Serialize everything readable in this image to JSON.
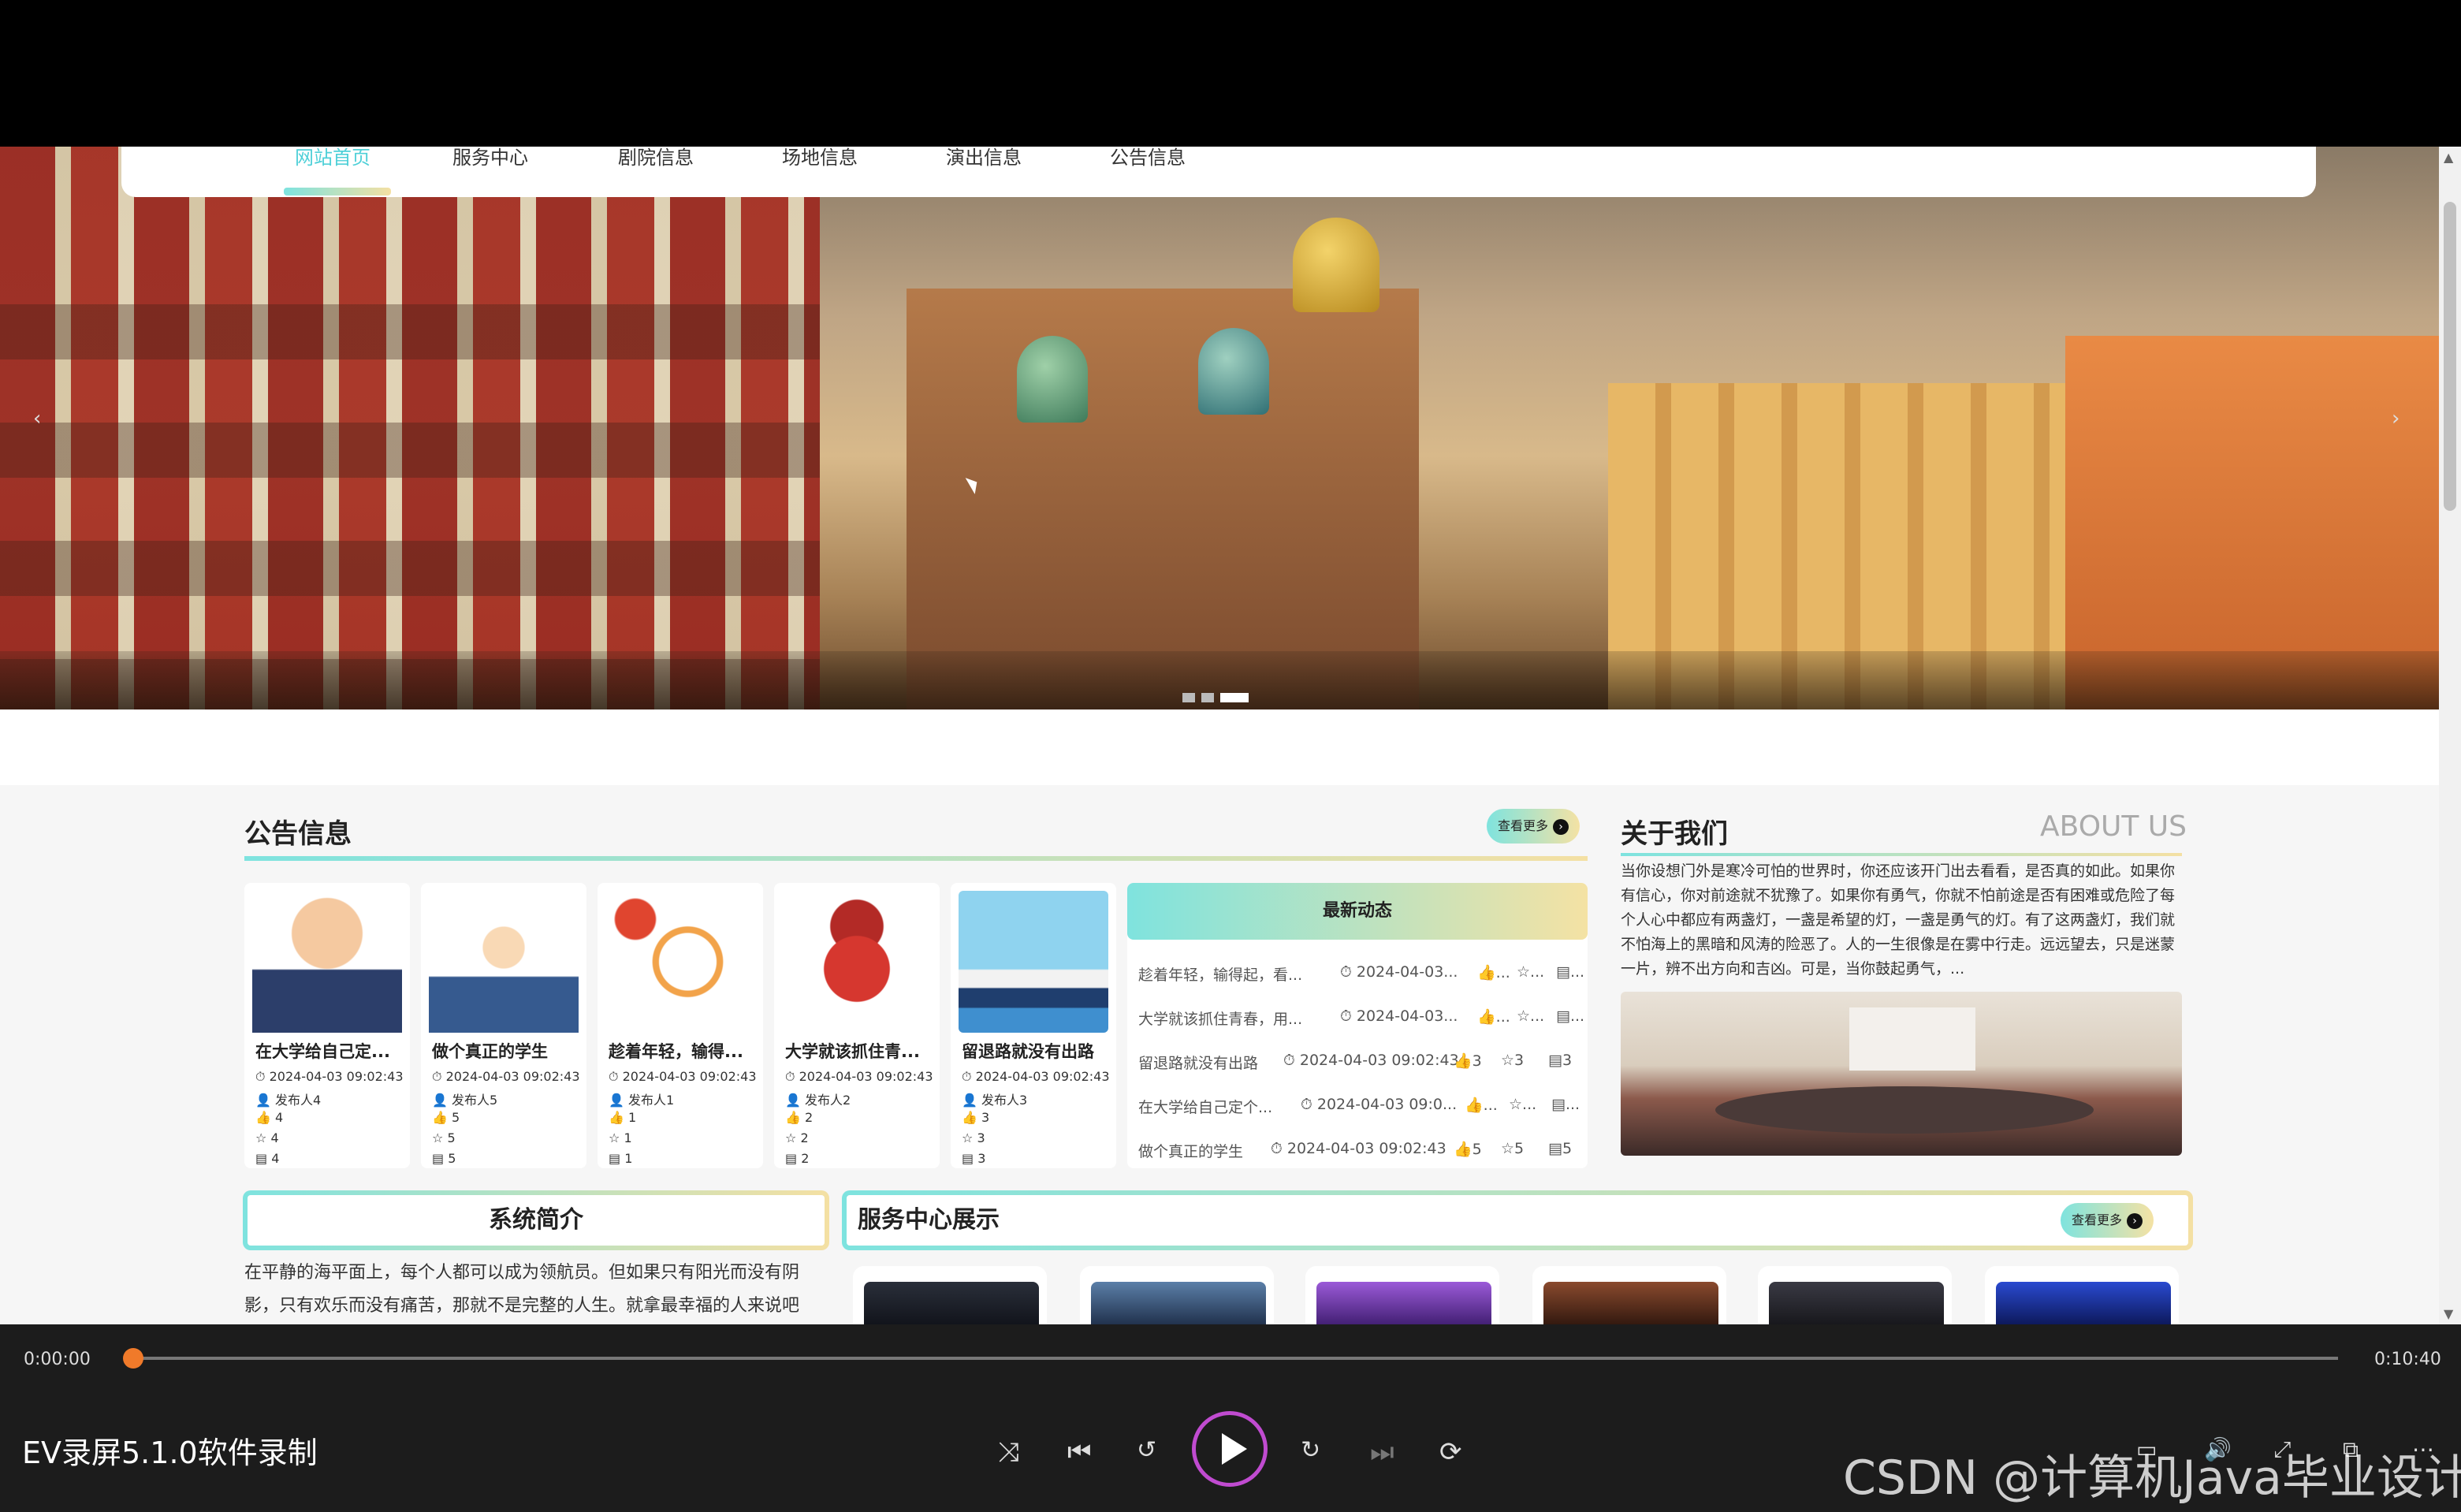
{
  "nav": {
    "items": [
      "网站首页",
      "服务中心",
      "剧院信息",
      "场地信息",
      "演出信息",
      "公告信息"
    ],
    "active_index": 0
  },
  "carousel": {
    "prev_icon": "‹",
    "next_icon": "›",
    "slide_count": 3,
    "active_slide": 3
  },
  "notices": {
    "title": "公告信息",
    "more_label": "查看更多",
    "cards": [
      {
        "title": "在大学给自己定...",
        "time": "2024-04-03 09:02:43",
        "author": "发布人4",
        "likes": "4",
        "favorites": "4",
        "views": "4"
      },
      {
        "title": "做个真正的学生",
        "time": "2024-04-03 09:02:43",
        "author": "发布人5",
        "likes": "5",
        "favorites": "5",
        "views": "5"
      },
      {
        "title": "趁着年轻，输得...",
        "time": "2024-04-03 09:02:43",
        "author": "发布人1",
        "likes": "1",
        "favorites": "1",
        "views": "1"
      },
      {
        "title": "大学就该抓住青...",
        "time": "2024-04-03 09:02:43",
        "author": "发布人2",
        "likes": "2",
        "favorites": "2",
        "views": "2"
      },
      {
        "title": "留退路就没有出路",
        "time": "2024-04-03 09:02:43",
        "author": "发布人3",
        "likes": "3",
        "favorites": "3",
        "views": "3"
      }
    ]
  },
  "news": {
    "title": "最新动态",
    "rows": [
      {
        "title": "趁着年轻，输得起，看...",
        "time": "2024-04-03...",
        "likes": "...",
        "favorites": "...",
        "views": "..."
      },
      {
        "title": "大学就该抓住青春，用...",
        "time": "2024-04-03...",
        "likes": "...",
        "favorites": "...",
        "views": "..."
      },
      {
        "title": "留退路就没有出路",
        "time": "2024-04-03 09:02:43",
        "likes": "3",
        "favorites": "3",
        "views": "3"
      },
      {
        "title": "在大学给自己定个...",
        "time": "2024-04-03 09:0...",
        "likes": "...",
        "favorites": "...",
        "views": "..."
      },
      {
        "title": "做个真正的学生",
        "time": "2024-04-03 09:02:43",
        "likes": "5",
        "favorites": "5",
        "views": "5"
      }
    ]
  },
  "about": {
    "title": "关于我们",
    "subtitle_en": "ABOUT US",
    "text": "当你设想门外是寒冷可怕的世界时，你还应该开门出去看看，是否真的如此。如果你有信心，你对前途就不犹豫了。如果你有勇气，你就不怕前途是否有困难或危险了每个人心中都应有两盏灯，一盏是希望的灯，一盏是勇气的灯。有了这两盏灯，我们就不怕海上的黑暗和风涛的险恶了。人的一生很像是在雾中行走。远远望去，只是迷蒙一片，辨不出方向和吉凶。可是，当你鼓起勇气，..."
  },
  "intro": {
    "title": "系统简介",
    "text": "在平静的海平面上，每个人都可以成为领航员。但如果只有阳光而没有阴影，只有欢乐而没有痛苦，那就不是完整的人生。就拿最幸福的人来说吧"
  },
  "services": {
    "title": "服务中心展示",
    "more_label": "查看更多"
  },
  "player": {
    "current_time": "0:00:00",
    "total_time": "0:10:40",
    "progress": 0,
    "app_title": "EV录屏5.1.0软件录制",
    "icons": [
      "shuffle-icon",
      "previous-icon",
      "rewind-10-icon",
      "play-icon",
      "forward-30-icon",
      "next-icon",
      "repeat-off-icon"
    ]
  },
  "watermark": "CSDN @计算机Java毕业设计",
  "colors": {
    "accent_teal": "#7ee3df",
    "accent_gold": "#f4e0a3",
    "nav_active": "#4fd0d8",
    "progress_knob": "#f07a2a"
  }
}
